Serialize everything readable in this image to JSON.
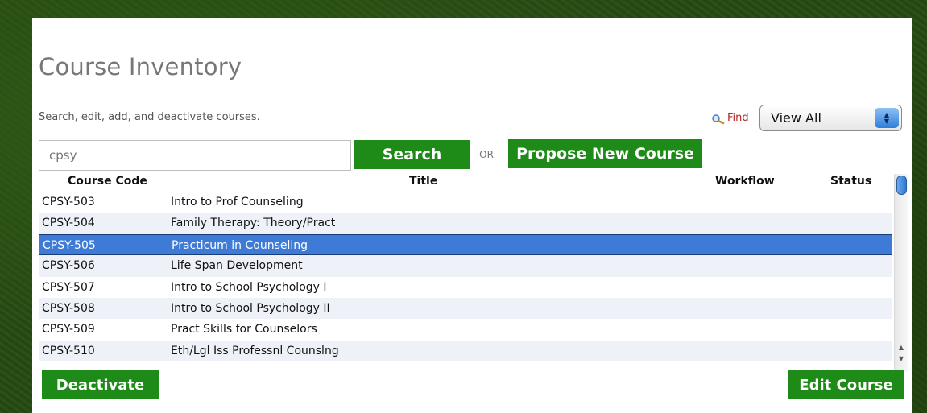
{
  "page": {
    "title": "Course Inventory",
    "subtitle": "Search, edit, add, and deactivate courses."
  },
  "find": {
    "label": "Find"
  },
  "filter": {
    "selected": "View All"
  },
  "search": {
    "value": "cpsy",
    "button_label": "Search"
  },
  "separator": "- OR -",
  "propose": {
    "label": "Propose New Course"
  },
  "table": {
    "headers": {
      "code": "Course Code",
      "title": "Title",
      "workflow": "Workflow",
      "status": "Status"
    },
    "rows": [
      {
        "code": "CPSY-503",
        "title": "Intro to Prof Counseling",
        "workflow": "",
        "status": ""
      },
      {
        "code": "CPSY-504",
        "title": "Family Therapy: Theory/Pract",
        "workflow": "",
        "status": ""
      },
      {
        "code": "CPSY-505",
        "title": "Practicum in Counseling",
        "workflow": "",
        "status": ""
      },
      {
        "code": "CPSY-506",
        "title": "Life Span Development",
        "workflow": "",
        "status": ""
      },
      {
        "code": "CPSY-507",
        "title": "Intro to School Psychology I",
        "workflow": "",
        "status": ""
      },
      {
        "code": "CPSY-508",
        "title": "Intro to School Psychology II",
        "workflow": "",
        "status": ""
      },
      {
        "code": "CPSY-509",
        "title": "Pract Skills for Counselors",
        "workflow": "",
        "status": ""
      },
      {
        "code": "CPSY-510",
        "title": "Eth/Lgl Iss Professnl Counslng",
        "workflow": "",
        "status": ""
      }
    ],
    "selected_index": 2
  },
  "actions": {
    "deactivate_label": "Deactivate",
    "edit_label": "Edit Course"
  },
  "colors": {
    "button_green": "#1e8a17",
    "selection_blue": "#3d7bd6",
    "link_red": "#b4271f",
    "alt_row": "#eef1f7"
  },
  "icons": {
    "find": "magnifier-icon",
    "select": "up-down-arrows-icon"
  }
}
